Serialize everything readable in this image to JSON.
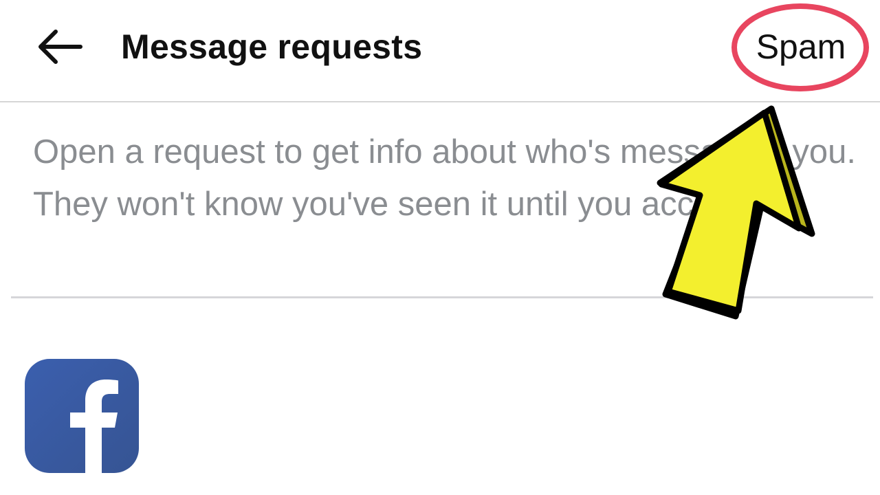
{
  "header": {
    "back_icon": "arrow-left-icon",
    "title": "Message requests",
    "spam_label": "Spam"
  },
  "info": {
    "text": "Open a request to get info about who's messaging you. They won't know you've seen it until you accept."
  },
  "logo": {
    "icon": "facebook-logo-icon",
    "color": "#3b5998"
  },
  "annotations": {
    "circle_color": "#e8455f",
    "arrow_fill": "#f3ef2e",
    "arrow_outline": "#000000"
  }
}
